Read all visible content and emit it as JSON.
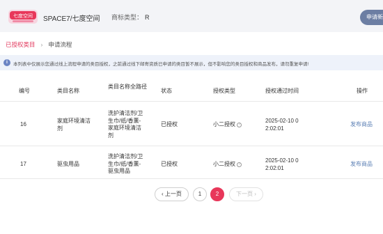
{
  "header": {
    "shop_name": "SPACE7/七度空间",
    "brand_type_label": "商标类型：",
    "brand_type_value": "R",
    "top_button_label": "申请新"
  },
  "breadcrumb": {
    "link": "已授权类目",
    "separator": "›",
    "current": "申请流程"
  },
  "notice": {
    "icon": "info-icon",
    "text": "本列表中仅展示您通过线上流程申请的类目授权，之前通过线下邮寄资质已申请的类目暂不展示，但不影响您的类目授权和商品发布，请勿重复申请!"
  },
  "table": {
    "headers": [
      "编号",
      "类目名称",
      "类目名称全路径",
      "状态",
      "授权类型",
      "授权通过时间",
      "操作"
    ],
    "rows": [
      {
        "id": "16",
        "name_lines": [
          "家庭环境清洁",
          "剂"
        ],
        "path_lines": [
          "洗护清洁剂/卫",
          "生巾/纸/香薰-",
          "家庭环境清洁",
          "剂"
        ],
        "status": "已授权",
        "auth_type": "小二授权",
        "time_lines": [
          "2025-02-10 0",
          "2:02:01"
        ],
        "action": "发布商品"
      },
      {
        "id": "17",
        "name_lines": [
          "驱虫用品"
        ],
        "path_lines": [
          "洗护清洁剂/卫",
          "生巾/纸/香薰-",
          "驱虫用品"
        ],
        "status": "已授权",
        "auth_type": "小二授权",
        "time_lines": [
          "2025-02-10 0",
          "2:02:01"
        ],
        "action": "发布商品"
      }
    ]
  },
  "pagination": {
    "prev": "‹ 上一页",
    "pages": [
      "1",
      "2"
    ],
    "current": "2",
    "next": "下一页 ›"
  },
  "colors": {
    "accent": "#e8375a",
    "link": "#5b7fb4",
    "header_bg": "#f3f4f7",
    "notice_bg": "#eef2fa"
  }
}
